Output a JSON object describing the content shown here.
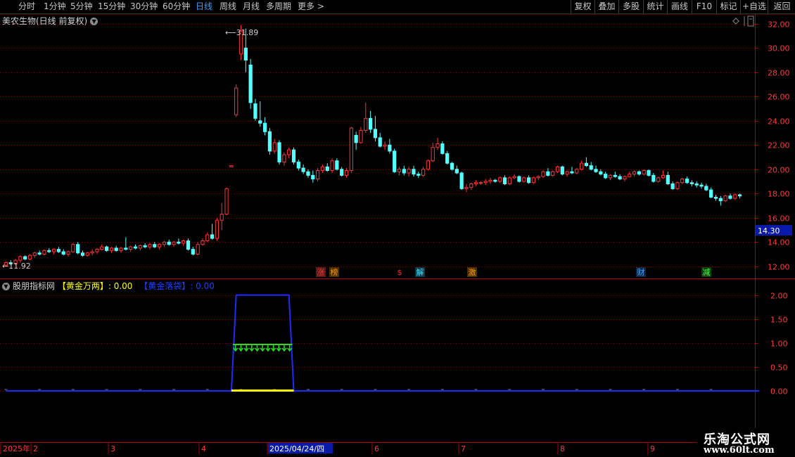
{
  "toolbar": {
    "periods": [
      "分时",
      "1分钟",
      "5分钟",
      "15分钟",
      "30分钟",
      "60分钟",
      "日线",
      "周线",
      "月线",
      "多周期",
      "更多"
    ],
    "active_period": "日线",
    "more_arrow": ">",
    "right_buttons": [
      "复权",
      "叠加",
      "多股",
      "统计",
      "画线",
      "F10",
      "标记",
      "+自选",
      "返回"
    ]
  },
  "stock": {
    "title": "美农生物(日线 前复权)",
    "dropdown_icon": "chevron-down-icon"
  },
  "price_axis": {
    "ticks": [
      "32.00",
      "30.00",
      "28.00",
      "26.00",
      "24.00",
      "22.00",
      "20.00",
      "18.00",
      "16.00",
      "14.00",
      "12.00"
    ],
    "current_marker": "14.30"
  },
  "annotations": {
    "high": "31.89",
    "low": "11.92"
  },
  "event_tags": [
    {
      "text": "涨",
      "color": "#ff3030",
      "bg": "#5a1a1a"
    },
    {
      "text": "榜",
      "color": "#ff9900",
      "bg": "#4a3000"
    },
    {
      "text": "$",
      "color": "#ff3030",
      "bg": "#000000"
    },
    {
      "text": "解",
      "color": "#40e0ff",
      "bg": "#103848"
    },
    {
      "text": "激",
      "color": "#ff9900",
      "bg": "#4a3000"
    },
    {
      "text": "财",
      "color": "#40a0ff",
      "bg": "#102848"
    },
    {
      "text": "减",
      "color": "#40ff40",
      "bg": "#104010"
    }
  ],
  "indicator": {
    "name": "股朋指标网",
    "line1_label": "【黄金万两】",
    "line1_value": ": 0.00",
    "line2_label": "【黄金落袋】",
    "line2_value": ": 0.00",
    "axis_ticks": [
      "2.00",
      "1.50",
      "1.00",
      "0.50",
      "0.00"
    ]
  },
  "date_axis": {
    "labels": [
      "2025年",
      "2",
      "3",
      "4",
      "2025/04/24/四",
      "6",
      "7",
      "8",
      "9"
    ]
  },
  "watermark": {
    "line1": "乐淘公式网",
    "line2": "www.60lt.com"
  },
  "chart_data": {
    "type": "candlestick",
    "ylim": [
      11.0,
      32.8
    ],
    "up_color": "#ff3333",
    "down_color": "#54ffff",
    "ohlc": [
      [
        12.1,
        12.4,
        12.0,
        12.3
      ],
      [
        12.3,
        12.5,
        12.1,
        12.2
      ],
      [
        12.2,
        12.6,
        12.1,
        12.5
      ],
      [
        12.5,
        12.9,
        12.3,
        12.8
      ],
      [
        12.8,
        12.9,
        12.5,
        12.6
      ],
      [
        12.6,
        13.0,
        12.5,
        12.9
      ],
      [
        12.9,
        13.2,
        12.7,
        13.1
      ],
      [
        13.1,
        13.3,
        12.9,
        13.0
      ],
      [
        13.0,
        13.4,
        12.9,
        13.3
      ],
      [
        13.3,
        13.5,
        13.1,
        13.2
      ],
      [
        13.2,
        13.5,
        13.0,
        13.4
      ],
      [
        13.4,
        13.6,
        13.1,
        13.2
      ],
      [
        13.2,
        13.4,
        12.9,
        13.0
      ],
      [
        13.0,
        13.3,
        12.8,
        13.2
      ],
      [
        13.2,
        13.9,
        13.1,
        13.8
      ],
      [
        13.8,
        14.0,
        13.0,
        13.1
      ],
      [
        13.1,
        13.3,
        12.8,
        12.9
      ],
      [
        12.9,
        13.2,
        12.8,
        13.1
      ],
      [
        13.1,
        13.4,
        12.9,
        13.2
      ],
      [
        13.2,
        13.5,
        13.0,
        13.4
      ],
      [
        13.4,
        13.8,
        13.3,
        13.6
      ],
      [
        13.6,
        13.7,
        13.2,
        13.3
      ],
      [
        13.3,
        13.6,
        13.1,
        13.5
      ],
      [
        13.5,
        13.7,
        13.2,
        13.3
      ],
      [
        13.3,
        13.6,
        13.1,
        13.5
      ],
      [
        13.5,
        14.4,
        13.3,
        13.4
      ],
      [
        13.4,
        13.7,
        13.2,
        13.6
      ],
      [
        13.6,
        13.8,
        13.4,
        13.5
      ],
      [
        13.5,
        13.8,
        13.3,
        13.7
      ],
      [
        13.7,
        13.9,
        13.5,
        13.6
      ],
      [
        13.6,
        13.9,
        13.4,
        13.8
      ],
      [
        13.8,
        14.0,
        13.5,
        13.6
      ],
      [
        13.6,
        13.9,
        13.4,
        13.8
      ],
      [
        13.8,
        14.1,
        13.6,
        14.0
      ],
      [
        14.0,
        14.2,
        13.7,
        13.8
      ],
      [
        13.8,
        14.1,
        13.6,
        14.0
      ],
      [
        14.0,
        14.3,
        13.8,
        13.9
      ],
      [
        13.9,
        14.2,
        13.7,
        14.1
      ],
      [
        14.1,
        14.3,
        13.3,
        13.4
      ],
      [
        13.4,
        13.6,
        12.9,
        13.0
      ],
      [
        13.0,
        14.0,
        12.9,
        13.8
      ],
      [
        13.8,
        14.3,
        13.7,
        14.1
      ],
      [
        14.1,
        14.8,
        14.0,
        14.6
      ],
      [
        14.6,
        15.5,
        14.2,
        14.3
      ],
      [
        14.3,
        16.0,
        14.1,
        15.8
      ],
      [
        15.8,
        17.2,
        15.0,
        16.3
      ],
      [
        16.3,
        18.5,
        16.2,
        18.4
      ],
      [
        20.2,
        20.3,
        20.2,
        20.3
      ],
      [
        24.5,
        27.0,
        24.3,
        26.7
      ],
      [
        29.5,
        31.89,
        29.0,
        31.4
      ],
      [
        30.0,
        31.6,
        28.0,
        29.0
      ],
      [
        28.6,
        29.1,
        25.0,
        25.5
      ],
      [
        25.4,
        25.8,
        24.0,
        24.2
      ],
      [
        24.0,
        25.6,
        23.5,
        23.8
      ],
      [
        23.8,
        24.3,
        22.8,
        23.1
      ],
      [
        23.1,
        23.4,
        21.2,
        21.5
      ],
      [
        21.5,
        22.5,
        21.3,
        22.2
      ],
      [
        22.2,
        22.4,
        20.4,
        20.6
      ],
      [
        20.6,
        21.4,
        20.3,
        21.2
      ],
      [
        21.2,
        21.8,
        20.9,
        21.6
      ],
      [
        21.6,
        21.8,
        20.4,
        20.6
      ],
      [
        20.6,
        20.8,
        19.9,
        20.1
      ],
      [
        20.1,
        20.4,
        19.6,
        19.8
      ],
      [
        19.8,
        20.0,
        19.3,
        19.5
      ],
      [
        19.5,
        19.9,
        18.9,
        19.2
      ],
      [
        19.2,
        20.1,
        19.0,
        19.9
      ],
      [
        19.9,
        20.4,
        19.7,
        20.2
      ],
      [
        20.2,
        20.5,
        19.8,
        19.9
      ],
      [
        19.9,
        20.9,
        19.7,
        20.7
      ],
      [
        20.7,
        20.9,
        19.9,
        20.0
      ],
      [
        20.0,
        20.2,
        19.4,
        19.5
      ],
      [
        19.5,
        20.1,
        19.3,
        19.9
      ],
      [
        19.9,
        23.5,
        19.7,
        23.4
      ],
      [
        22.8,
        23.1,
        21.6,
        22.2
      ],
      [
        22.2,
        23.5,
        22.1,
        23.2
      ],
      [
        23.2,
        25.5,
        23.0,
        24.2
      ],
      [
        24.2,
        24.8,
        23.0,
        23.3
      ],
      [
        23.3,
        24.4,
        22.3,
        22.6
      ],
      [
        22.6,
        23.0,
        21.8,
        21.9
      ],
      [
        21.9,
        22.3,
        21.6,
        22.0
      ],
      [
        22.0,
        22.5,
        21.3,
        21.5
      ],
      [
        21.5,
        21.7,
        19.7,
        19.8
      ],
      [
        19.8,
        20.2,
        19.5,
        20.0
      ],
      [
        20.0,
        20.3,
        19.5,
        19.7
      ],
      [
        19.7,
        20.2,
        19.4,
        20.0
      ],
      [
        20.0,
        20.3,
        19.4,
        19.6
      ],
      [
        19.6,
        19.8,
        19.3,
        19.5
      ],
      [
        19.5,
        20.2,
        19.4,
        20.0
      ],
      [
        20.0,
        20.8,
        19.9,
        20.7
      ],
      [
        20.7,
        22.2,
        20.6,
        21.8
      ],
      [
        21.8,
        22.6,
        21.6,
        22.1
      ],
      [
        22.1,
        22.3,
        21.2,
        21.3
      ],
      [
        21.3,
        21.5,
        20.4,
        20.5
      ],
      [
        20.5,
        20.6,
        19.9,
        20.0
      ],
      [
        20.0,
        20.3,
        19.6,
        19.7
      ],
      [
        19.7,
        19.8,
        18.3,
        18.4
      ],
      [
        18.4,
        18.8,
        18.1,
        18.5
      ],
      [
        18.5,
        18.9,
        18.3,
        18.8
      ],
      [
        18.8,
        19.1,
        18.6,
        18.9
      ],
      [
        18.9,
        19.0,
        18.7,
        18.9
      ],
      [
        18.9,
        19.2,
        18.7,
        19.0
      ],
      [
        19.0,
        19.3,
        18.8,
        19.1
      ],
      [
        19.1,
        19.2,
        18.9,
        19.0
      ],
      [
        19.0,
        19.4,
        18.9,
        19.3
      ],
      [
        19.3,
        19.5,
        18.7,
        18.8
      ],
      [
        18.8,
        19.4,
        18.7,
        19.3
      ],
      [
        19.3,
        19.6,
        19.2,
        19.4
      ],
      [
        19.4,
        19.5,
        18.9,
        19.0
      ],
      [
        19.0,
        19.4,
        18.9,
        19.3
      ],
      [
        19.3,
        19.5,
        18.8,
        18.9
      ],
      [
        18.9,
        19.4,
        18.8,
        19.3
      ],
      [
        19.3,
        19.5,
        19.1,
        19.4
      ],
      [
        19.4,
        19.9,
        19.3,
        19.8
      ],
      [
        19.8,
        20.1,
        19.4,
        19.5
      ],
      [
        19.5,
        19.9,
        19.4,
        19.8
      ],
      [
        19.8,
        20.3,
        19.7,
        20.2
      ],
      [
        20.2,
        20.3,
        19.5,
        19.6
      ],
      [
        19.6,
        19.9,
        19.4,
        19.8
      ],
      [
        19.8,
        20.2,
        19.6,
        19.7
      ],
      [
        19.7,
        20.1,
        19.6,
        20.0
      ],
      [
        20.0,
        20.7,
        19.9,
        20.5
      ],
      [
        20.5,
        21.0,
        20.2,
        20.3
      ],
      [
        20.3,
        20.6,
        19.9,
        20.0
      ],
      [
        20.0,
        20.3,
        19.7,
        19.8
      ],
      [
        19.8,
        20.0,
        19.5,
        19.6
      ],
      [
        19.6,
        19.8,
        19.2,
        19.3
      ],
      [
        19.3,
        19.6,
        19.1,
        19.5
      ],
      [
        19.5,
        19.8,
        19.3,
        19.4
      ],
      [
        19.4,
        19.6,
        19.1,
        19.2
      ],
      [
        19.2,
        19.5,
        19.0,
        19.4
      ],
      [
        19.4,
        19.8,
        19.3,
        19.6
      ],
      [
        19.6,
        19.9,
        19.4,
        19.8
      ],
      [
        19.8,
        19.9,
        19.5,
        19.6
      ],
      [
        19.6,
        20.0,
        19.5,
        19.9
      ],
      [
        19.9,
        20.0,
        19.4,
        19.5
      ],
      [
        19.5,
        19.7,
        18.9,
        19.0
      ],
      [
        19.0,
        19.4,
        18.9,
        19.3
      ],
      [
        19.3,
        19.9,
        19.2,
        19.5
      ],
      [
        19.5,
        19.8,
        18.7,
        18.8
      ],
      [
        18.8,
        19.0,
        18.3,
        18.4
      ],
      [
        18.4,
        19.0,
        18.3,
        18.9
      ],
      [
        18.9,
        19.3,
        18.8,
        19.2
      ],
      [
        19.2,
        19.4,
        18.8,
        18.9
      ],
      [
        18.9,
        19.1,
        18.6,
        18.8
      ],
      [
        18.8,
        19.0,
        18.5,
        18.7
      ],
      [
        18.7,
        18.9,
        18.4,
        18.6
      ],
      [
        18.6,
        18.8,
        18.2,
        18.3
      ],
      [
        18.3,
        18.5,
        17.6,
        17.7
      ],
      [
        17.7,
        17.9,
        17.4,
        17.6
      ],
      [
        17.6,
        17.8,
        17.0,
        17.4
      ],
      [
        17.4,
        17.9,
        17.3,
        17.8
      ],
      [
        17.8,
        18.0,
        17.5,
        17.6
      ],
      [
        17.6,
        18.0,
        17.5,
        17.9
      ],
      [
        17.9,
        18.0,
        17.6,
        17.8
      ]
    ],
    "indicator": {
      "name": "股朋指标网",
      "ylim": [
        0,
        2.2
      ],
      "blue_series": [
        0,
        0,
        0,
        0,
        0,
        0,
        0,
        0,
        0,
        0,
        0,
        0,
        0,
        0,
        0,
        0,
        0,
        0,
        0,
        0,
        0,
        0,
        0,
        0,
        0,
        0,
        0,
        0,
        0,
        0,
        0,
        0,
        0,
        0,
        0,
        0,
        0,
        0,
        0,
        0,
        0,
        0,
        0,
        0,
        0,
        0,
        0,
        0,
        2,
        2,
        2,
        2,
        2,
        2,
        2,
        2,
        2,
        2,
        2,
        2,
        0,
        0,
        0,
        0,
        0,
        0,
        0,
        0,
        0,
        0,
        0,
        0,
        0,
        0,
        0,
        0,
        0,
        0,
        0,
        0,
        0,
        0,
        0,
        0,
        0,
        0,
        0,
        0,
        0,
        0,
        0,
        0,
        0,
        0,
        0,
        0,
        0,
        0,
        0,
        0,
        0,
        0,
        0,
        0,
        0,
        0,
        0,
        0,
        0,
        0,
        0,
        0,
        0,
        0,
        0,
        0,
        0,
        0,
        0,
        0,
        0,
        0,
        0,
        0,
        0,
        0,
        0,
        0,
        0,
        0,
        0,
        0,
        0,
        0,
        0,
        0,
        0,
        0,
        0,
        0,
        0,
        0,
        0,
        0,
        0,
        0,
        0,
        0,
        0,
        0,
        0,
        0,
        0,
        0,
        0,
        0,
        0,
        0
      ],
      "arrow_level": 0.88,
      "arrow_count": 11
    }
  }
}
